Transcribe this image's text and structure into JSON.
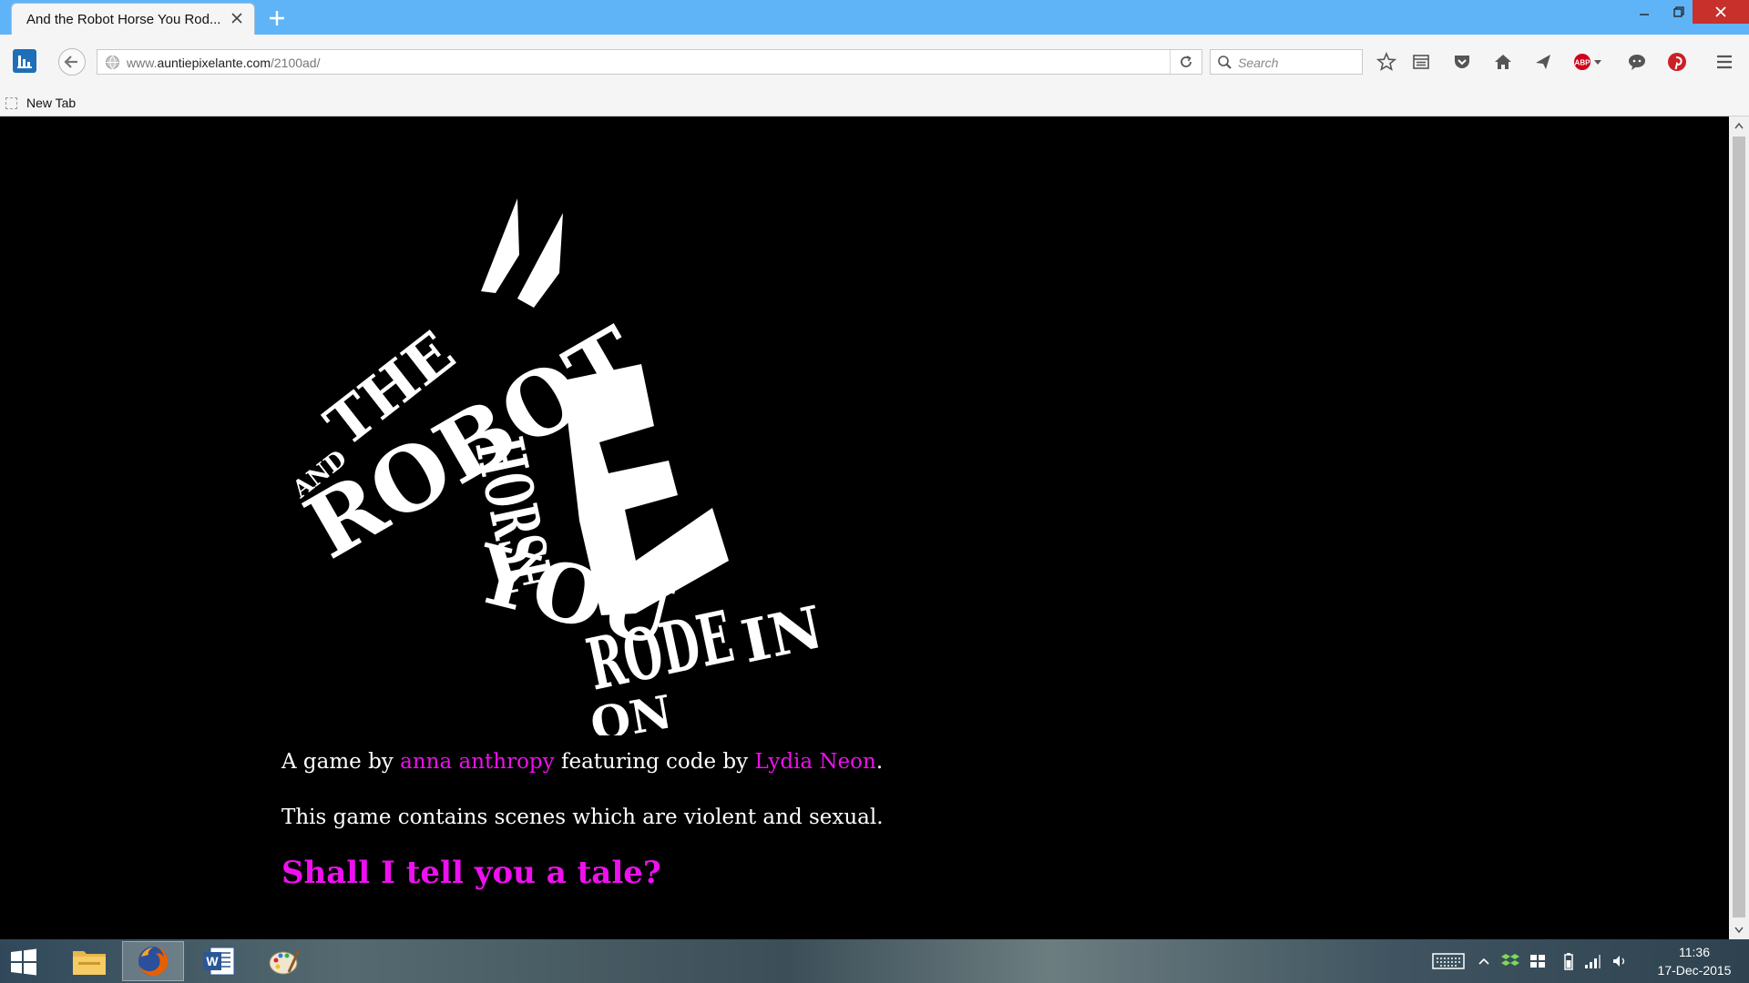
{
  "browser": {
    "tab_title": "And the Robot Horse You Rod...",
    "url_prefix": "www.",
    "url_host": "auntiepixelante.com",
    "url_path": "/2100ad/",
    "search_placeholder": "Search",
    "bookmark_label": "New Tab",
    "icons": [
      "app-icon",
      "back-icon",
      "globe-icon",
      "reload-icon",
      "search-icon",
      "star-icon",
      "reading-list-icon",
      "pocket-icon",
      "home-icon",
      "send-icon",
      "adblock-icon",
      "chat-icon",
      "pinterest-icon",
      "menu-icon"
    ]
  },
  "logo": {
    "words": [
      "AND",
      "THE",
      "ROBOT",
      "HORSE",
      "YOU",
      "RODE",
      "IN",
      "ON"
    ]
  },
  "page": {
    "credits_prefix": "A game by ",
    "author1": "anna anthropy",
    "credits_mid": " featuring code by ",
    "author2": "Lydia Neon",
    "credits_suffix": ".",
    "warning": "This game contains scenes which are violent and sexual.",
    "tale_link": "Shall I tell you a tale?"
  },
  "taskbar": {
    "time": "11:36",
    "date": "17-Dec-2015",
    "apps": [
      "file-explorer-icon",
      "firefox-icon",
      "word-icon",
      "paint-icon"
    ]
  },
  "colors": {
    "link": "#ee10ee",
    "titlebar": "#5fb4f8",
    "close": "#c7302b"
  }
}
